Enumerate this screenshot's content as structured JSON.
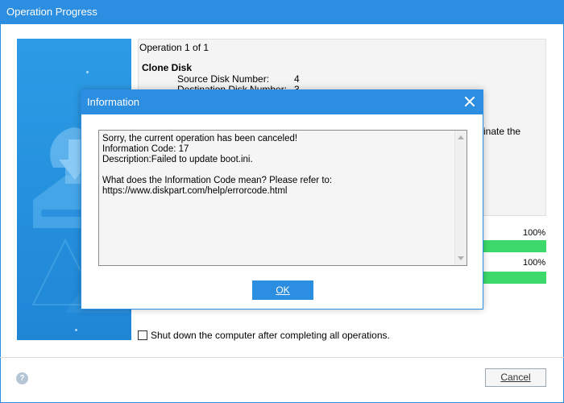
{
  "main": {
    "title": "Operation Progress",
    "operation_header": "Operation 1 of 1",
    "operation_title": "Clone Disk",
    "rows": [
      {
        "label": "Source Disk Number:",
        "value": "4"
      },
      {
        "label": "Destination Disk Number:",
        "value": "3"
      }
    ],
    "truncated_text": "inate the",
    "progress": [
      {
        "percent_label": "100%",
        "value": 1.0
      },
      {
        "percent_label": "100%",
        "value": 1.0
      }
    ],
    "shutdown_label": "Shut down the computer after completing all operations.",
    "shutdown_checked": false,
    "help_glyph": "?",
    "cancel_label": "Cancel",
    "accent_color": "#2b8ee0",
    "progress_color": "#3dd96a"
  },
  "dialog": {
    "title": "Information",
    "message_lines": [
      "Sorry, the current operation has been canceled!",
      "Information Code: 17",
      "Description:Failed to update boot.ini.",
      "",
      "What does the Information Code mean? Please refer to:",
      "https://www.diskpart.com/help/errorcode.html"
    ],
    "ok_label": "OK"
  }
}
